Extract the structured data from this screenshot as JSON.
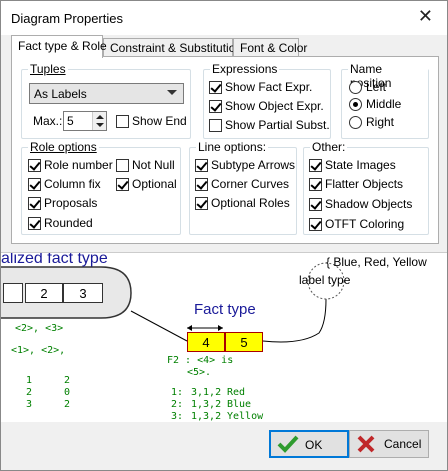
{
  "window": {
    "title": "Diagram Properties",
    "close": "✕"
  },
  "tabs": [
    {
      "label": "Fact type & Role"
    },
    {
      "label": "Constraint & Substitution"
    },
    {
      "label": "Font & Color"
    }
  ],
  "tuples": {
    "title": "Tuples",
    "select_value": "As Labels",
    "max_label": "Max.:",
    "max_value": "5",
    "show_end": {
      "label": "Show End",
      "checked": false
    }
  },
  "expressions": {
    "title": "Expressions",
    "items": [
      {
        "label": "Show Fact Expr.",
        "checked": true
      },
      {
        "label": "Show Object Expr.",
        "checked": true
      },
      {
        "label": "Show Partial Subst.",
        "checked": false
      }
    ]
  },
  "name_position": {
    "title": "Name position",
    "options": [
      {
        "label": "Left",
        "selected": false
      },
      {
        "label": "Middle",
        "selected": true
      },
      {
        "label": "Right",
        "selected": false
      }
    ]
  },
  "role_options": {
    "title": "Role options",
    "items": [
      {
        "label": "Role number",
        "checked": true
      },
      {
        "label": "Not Null",
        "checked": false
      },
      {
        "label": "Column fix",
        "checked": true
      },
      {
        "label": "Optional",
        "checked": true
      },
      {
        "label": "Proposals",
        "checked": true
      },
      {
        "label": "Rounded",
        "checked": true
      }
    ]
  },
  "line_options": {
    "title": "Line options:",
    "items": [
      {
        "label": "Subtype Arrows",
        "checked": true
      },
      {
        "label": "Corner Curves",
        "checked": true
      },
      {
        "label": "Optional Roles",
        "checked": true
      }
    ]
  },
  "other": {
    "title": "Other:",
    "items": [
      {
        "label": "State Images",
        "checked": true
      },
      {
        "label": "Flatter Objects",
        "checked": true
      },
      {
        "label": "Shadow Objects",
        "checked": true
      },
      {
        "label": "OTFT Coloring",
        "checked": true
      }
    ]
  },
  "preview": {
    "header_left": "alized fact type",
    "header_right": "{ Blue, Red, Yellow",
    "fact_type_label": "Fact type",
    "label_type": "label type",
    "role_2": "2",
    "role_3": "3",
    "role_4": "4",
    "role_5": "5",
    "green_a1": "<2>, <3>",
    "green_a2": "<1>, <2>,",
    "f2_line1": "F2 : <4> is",
    "f2_line2": "<5>.",
    "left_table": [
      [
        "1",
        "2"
      ],
      [
        "2",
        "0"
      ],
      [
        "3",
        "2"
      ]
    ],
    "right_table": [
      [
        "1:",
        "3,1,2",
        "Red"
      ],
      [
        "2:",
        "1,3,2",
        "Blue"
      ],
      [
        "3:",
        "1,3,2",
        "Yellow"
      ]
    ]
  },
  "buttons": {
    "ok": "OK",
    "cancel": "Cancel"
  },
  "colors": {
    "ok_check": "#2e9b2e",
    "cancel_x": "#c0282a",
    "role_fill": "#ffff00",
    "preview_title": "#1a1a99"
  }
}
